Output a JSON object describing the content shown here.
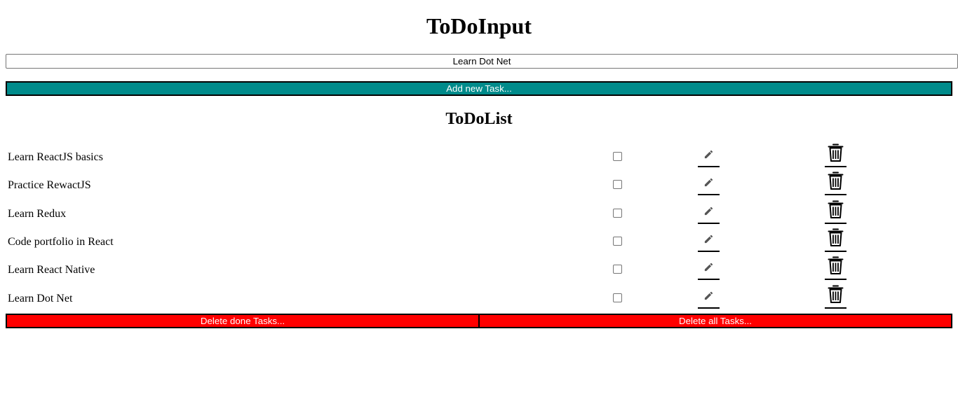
{
  "input_section": {
    "title": "ToDoInput",
    "task_input_value": "Learn Dot Net",
    "add_button_label": "Add new Task..."
  },
  "list_section": {
    "title": "ToDoList",
    "tasks": [
      {
        "text": "Learn ReactJS basics",
        "done": false
      },
      {
        "text": "Practice RewactJS",
        "done": false
      },
      {
        "text": "Learn Redux",
        "done": false
      },
      {
        "text": "Code portfolio in React",
        "done": false
      },
      {
        "text": "Learn React Native",
        "done": false
      },
      {
        "text": "Learn Dot Net",
        "done": false
      }
    ],
    "row_icons": {
      "edit": "pencil-icon",
      "delete": "trash-icon"
    }
  },
  "footer_buttons": {
    "delete_done_label": "Delete done Tasks...",
    "delete_all_label": "Delete all Tasks..."
  },
  "colors": {
    "add_button": "#008b8b",
    "delete_buttons": "#ff0000",
    "button_text": "#ffffff"
  }
}
